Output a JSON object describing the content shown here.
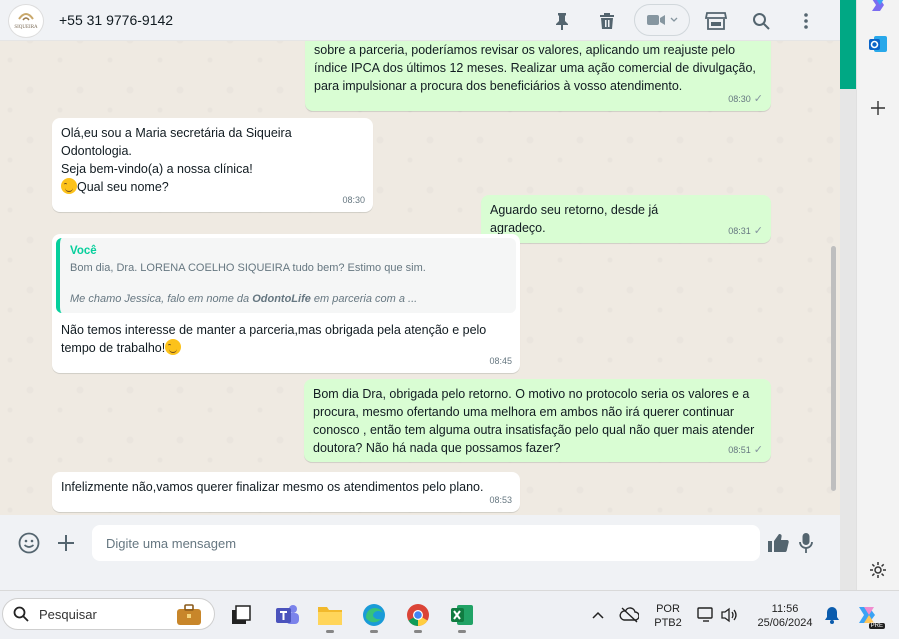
{
  "header": {
    "contact": "+55 31 9776-9142",
    "avatar_logo": "SIQUEIRA",
    "icons": [
      "pin-icon",
      "trash-icon",
      "video-call-icon",
      "shop-icon",
      "search-icon",
      "menu-icon"
    ]
  },
  "messages": [
    {
      "dir": "out",
      "lines": [
        "sobre a parceria, poderíamos revisar os valores, aplicando um reajuste pelo",
        "índice IPCA dos últimos 12 meses. Realizar uma ação comercial de divulgação,",
        "para impulsionar a procura dos beneficiários à vosso atendimento."
      ],
      "time": "08:30"
    },
    {
      "dir": "in",
      "lines": [
        "Olá,eu sou a Maria secretária da Siqueira Odontologia.",
        "Seja bem-vindo(a) a nossa clínica!",
        "Qual seu nome?"
      ],
      "time": "08:30"
    },
    {
      "dir": "out",
      "text": "Aguardo seu retorno, desde já agradeço.",
      "time": "08:31"
    },
    {
      "dir": "in",
      "quote_author": "Você",
      "quote_line1": "Bom dia, Dra. LORENA COELHO SIQUEIRA tudo bem? Estimo que sim.",
      "quote_line2_pre": "Me chamo Jessica, falo em nome da ",
      "quote_line2_bold": "OdontoLife",
      "quote_line2_post": " em parceria com a ...",
      "lines": [
        "Não temos interesse de manter a parceria,mas obrigada pela atenção e pelo",
        "tempo de trabalho!"
      ],
      "time": "08:45"
    },
    {
      "dir": "out",
      "lines": [
        "Bom dia Dra, obrigada pelo retorno. O motivo no protocolo seria os valores e a",
        "procura, mesmo ofertando uma melhora em ambos não irá querer continuar",
        "conosco , então tem alguma outra insatisfação pelo qual não quer mais atender",
        "doutora? Não há nada que possamos fazer?"
      ],
      "time": "08:51"
    },
    {
      "dir": "in",
      "text": "Infelizmente não,vamos querer finalizar mesmo os atendimentos pelo plano.",
      "time": "08:53"
    }
  ],
  "composer": {
    "placeholder": "Digite uma mensagem"
  },
  "taskbar": {
    "search_label": "Pesquisar",
    "lang_top": "POR",
    "lang_bottom": "PTB2",
    "time": "11:56",
    "date": "25/06/2024",
    "copilot_badge": "PRE"
  },
  "colors": {
    "outgoing_bubble": "#d9fdd3",
    "incoming_bubble": "#ffffff",
    "accent": "#00a884",
    "chat_bg": "#efeae2"
  }
}
